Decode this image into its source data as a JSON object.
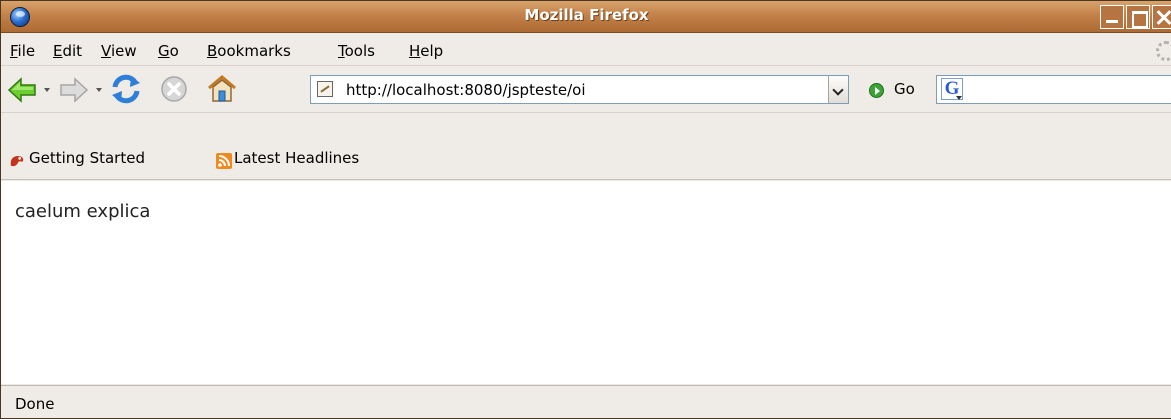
{
  "window": {
    "title": "Mozilla Firefox"
  },
  "menu": {
    "items": [
      {
        "label": "File",
        "mnemonic": "F"
      },
      {
        "label": "Edit",
        "mnemonic": "E"
      },
      {
        "label": "View",
        "mnemonic": "V"
      },
      {
        "label": "Go",
        "mnemonic": "G"
      },
      {
        "label": "Bookmarks",
        "mnemonic": "B"
      },
      {
        "label": "Tools",
        "mnemonic": "T"
      },
      {
        "label": "Help",
        "mnemonic": "H"
      }
    ]
  },
  "navigation": {
    "icons": [
      "back-arrow-icon",
      "forward-arrow-icon",
      "reload-icon",
      "stop-icon",
      "home-icon"
    ],
    "url": "http://localhost:8080/jspteste/oi",
    "go_label": "Go",
    "search_engine_icon": "google-icon"
  },
  "bookmarks": {
    "items": [
      {
        "label": "Getting Started",
        "icon": "firefox-bookmark-icon"
      },
      {
        "label": "Latest Headlines",
        "icon": "rss-feed-icon"
      }
    ]
  },
  "content": {
    "text": "caelum explica"
  },
  "status": {
    "text": "Done"
  },
  "colors": {
    "titlebar": "#c3824a",
    "chrome": "#efebe7",
    "go_green": "#3aa434",
    "back_green": "#5fbf2a"
  }
}
